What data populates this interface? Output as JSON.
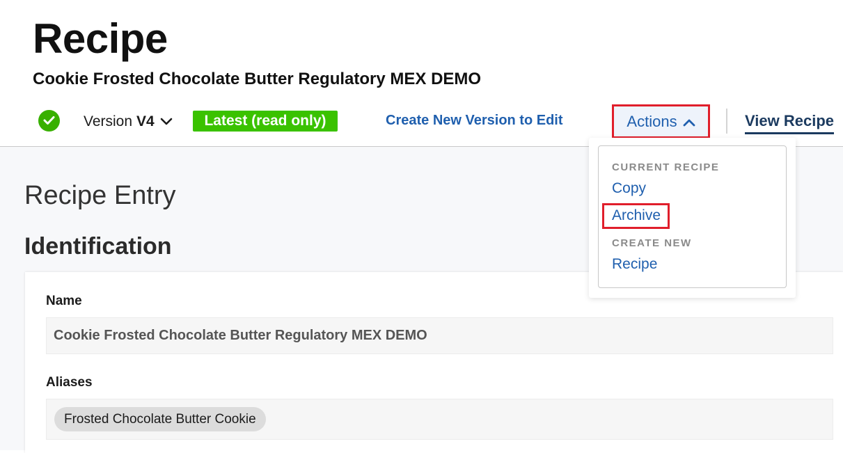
{
  "header": {
    "title": "Recipe",
    "subtitle": "Cookie Frosted Chocolate Butter Regulatory MEX DEMO"
  },
  "toolbar": {
    "status_icon": "check-circle-icon",
    "version_label": "Version",
    "version_value": "V4",
    "latest_badge": "Latest (read only)",
    "create_version_link": "Create New Version to Edit",
    "actions_label": "Actions",
    "view_recipe_link": "View Recipe"
  },
  "actions_menu": {
    "sections": [
      {
        "label": "CURRENT RECIPE",
        "items": [
          "Copy",
          "Archive"
        ]
      },
      {
        "label": "CREATE NEW",
        "items": [
          "Recipe"
        ]
      }
    ]
  },
  "main": {
    "heading": "Recipe Entry",
    "section_title": "Identification",
    "name_label": "Name",
    "name_value": "Cookie Frosted Chocolate Butter Regulatory MEX DEMO",
    "aliases_label": "Aliases",
    "aliases": [
      "Frosted Chocolate Butter Cookie"
    ]
  },
  "colors": {
    "success_green": "#38b000",
    "badge_green": "#3ac200",
    "link_blue": "#1f5fae",
    "highlight_red": "#e01e2b",
    "page_background": "#f7f8fa"
  }
}
